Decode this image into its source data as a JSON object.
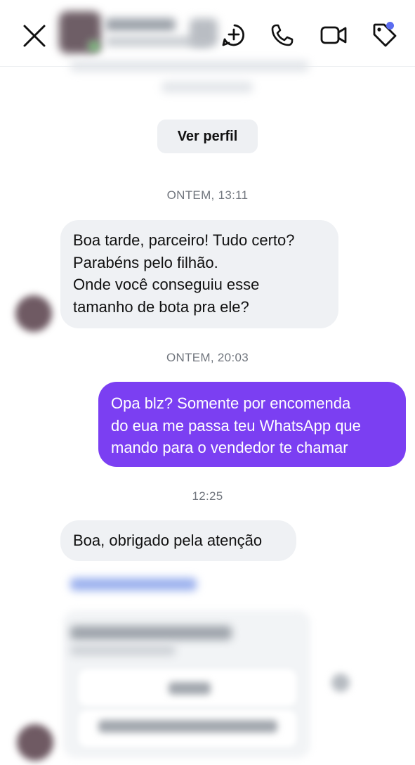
{
  "header": {
    "close_icon": "close-icon",
    "ai_icon": "ai-sparkle-icon",
    "call_icon": "phone-icon",
    "video_icon": "video-camera-icon",
    "label_icon": "tag-icon",
    "notification_dot_color": "#5b6cf0"
  },
  "profile_button": {
    "label": "Ver perfil"
  },
  "timestamps": {
    "first": "ONTEM, 13:11",
    "second": "ONTEM, 20:03",
    "third": "12:25"
  },
  "messages": [
    {
      "direction": "incoming",
      "lines": [
        "Boa tarde, parceiro! Tudo certo?",
        "Parabéns pelo filhão.",
        "Onde você conseguiu esse",
        "tamanho de bota pra ele?"
      ]
    },
    {
      "direction": "outgoing",
      "lines": [
        "Opa blz? Somente por encomenda",
        "do eua me passa teu WhatsApp que",
        "mando para o vendedor te chamar"
      ]
    },
    {
      "direction": "incoming",
      "lines": [
        "Boa, obrigado pela atenção"
      ]
    }
  ],
  "colors": {
    "outgoing_bubble": "#7b3ff2",
    "incoming_bubble": "#eff1f4",
    "timestamp_text": "#70757d"
  }
}
